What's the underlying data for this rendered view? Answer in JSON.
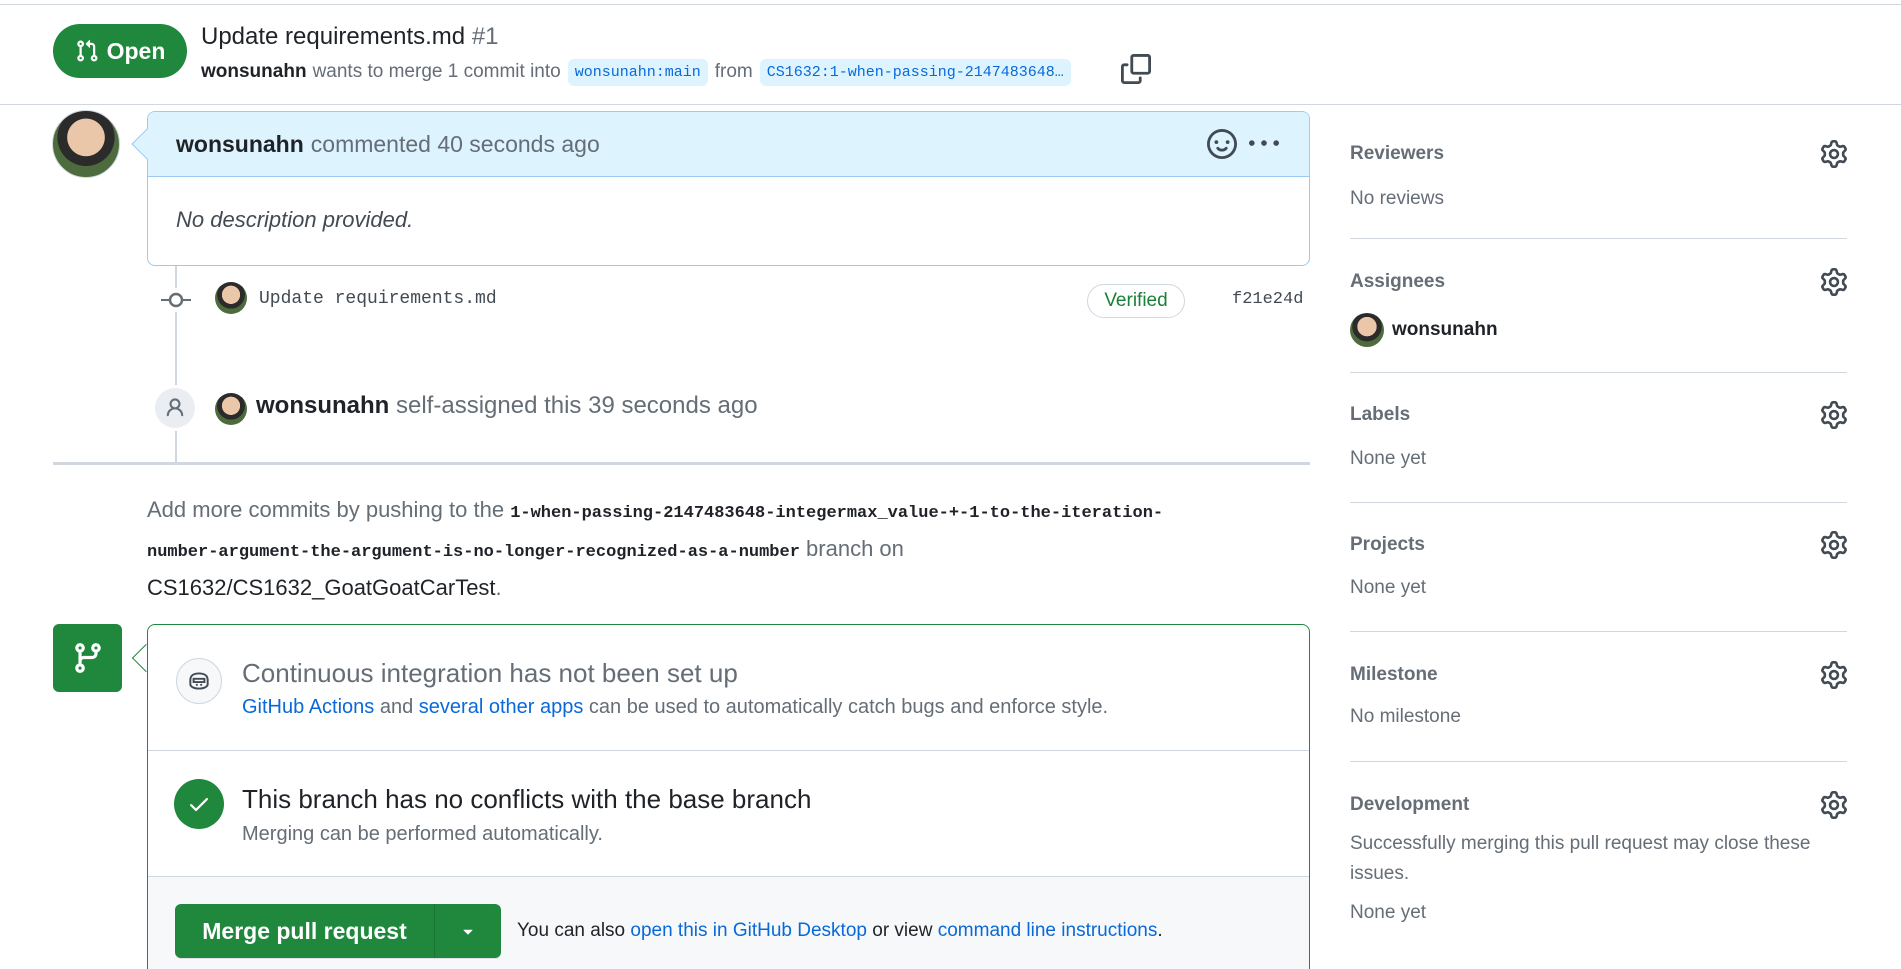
{
  "header": {
    "status_label": "Open",
    "title": "Update requirements.md",
    "number": "#1",
    "author": "wonsunahn",
    "merge_text": "wants to merge 1 commit into",
    "base_branch": "wonsunahn:main",
    "from_text": "from",
    "head_branch": "CS1632:1-when-passing-2147483648…"
  },
  "comment": {
    "author": "wonsunahn",
    "meta": "commented 40 seconds ago",
    "body": "No description provided."
  },
  "commit": {
    "message": "Update requirements.md",
    "verified_label": "Verified",
    "sha": "f21e24d"
  },
  "event": {
    "actor": "wonsunahn",
    "text": "self-assigned this 39 seconds ago"
  },
  "push_info": {
    "prefix": "Add more commits by pushing to the",
    "branch_line1": "1-when-passing-2147483648-integermax_value-+-1-to-the-iteration-",
    "branch_line2": "number-argument-the-argument-is-no-longer-recognized-as-a-number",
    "middle": "branch on",
    "repo": "CS1632/CS1632_GoatGoatCarTest",
    "suffix": "."
  },
  "merge": {
    "ci_title": "Continuous integration has not been set up",
    "ci_link1": "GitHub Actions",
    "ci_and": "and",
    "ci_link2": "several other apps",
    "ci_rest": "can be used to automatically catch bugs and enforce style.",
    "nc_title": "This branch has no conflicts with the base branch",
    "nc_desc": "Merging can be performed automatically.",
    "button_label": "Merge pull request",
    "alt_prefix": "You can also",
    "alt_link1": "open this in GitHub Desktop",
    "alt_middle": "or view",
    "alt_link2": "command line instructions",
    "alt_suffix": "."
  },
  "sidebar": {
    "reviewers": {
      "title": "Reviewers",
      "value": "No reviews"
    },
    "assignees": {
      "title": "Assignees",
      "value": "wonsunahn"
    },
    "labels": {
      "title": "Labels",
      "value": "None yet"
    },
    "projects": {
      "title": "Projects",
      "value": "None yet"
    },
    "milestone": {
      "title": "Milestone",
      "value": "No milestone"
    },
    "development": {
      "title": "Development",
      "desc": "Successfully merging this pull request may close these issues.",
      "value": "None yet"
    }
  },
  "colors": {
    "open_green": "#1f883d",
    "link_blue": "#0969da",
    "comment_header_bg": "#ddf4ff"
  },
  "icons": [
    "git-pull-request-icon",
    "copy-icon",
    "smiley-icon",
    "kebab-horizontal-icon",
    "git-commit-icon",
    "person-icon",
    "git-merge-icon",
    "copilot-icon",
    "check-icon",
    "triangle-down-icon",
    "gear-icon"
  ]
}
